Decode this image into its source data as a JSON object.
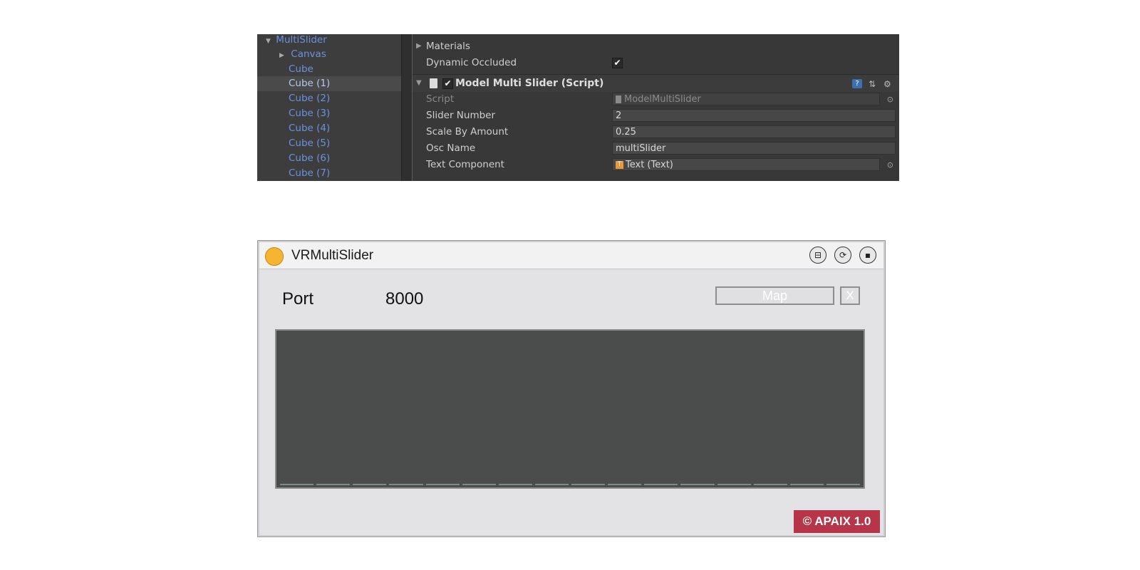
{
  "unity": {
    "hierarchy": {
      "root": "MultiSlider",
      "items": [
        {
          "label": "Canvas",
          "expandable": true
        },
        {
          "label": "Cube"
        },
        {
          "label": "Cube (1)",
          "selected": true
        },
        {
          "label": "Cube (2)"
        },
        {
          "label": "Cube (3)"
        },
        {
          "label": "Cube (4)"
        },
        {
          "label": "Cube (5)"
        },
        {
          "label": "Cube (6)"
        },
        {
          "label": "Cube (7)"
        }
      ]
    },
    "inspector": {
      "materials_label": "Materials",
      "dynamic_occluded_label": "Dynamic Occluded",
      "dynamic_occluded_checked": true,
      "component_title": "Model Multi Slider (Script)",
      "component_enabled": true,
      "fields": {
        "script_label": "Script",
        "script_value": "ModelMultiSlider",
        "slider_number_label": "Slider Number",
        "slider_number_value": "2",
        "scale_label": "Scale By Amount",
        "scale_value": "0.25",
        "osc_label": "Osc Name",
        "osc_value": "multiSlider",
        "text_component_label": "Text Component",
        "text_component_value": "Text (Text)"
      },
      "icons": [
        "help-icon",
        "preset-icon",
        "gear-icon"
      ]
    }
  },
  "max_patch": {
    "title": "VRMultiSlider",
    "status_color": "#f5b432",
    "title_buttons": [
      "freeze-icon",
      "refresh-icon",
      "save-icon"
    ],
    "port_label": "Port",
    "port_value": "8000",
    "map_button": "Map",
    "close_button": "X",
    "slider_count": 16,
    "slider_values": [
      0,
      0,
      0,
      0,
      0,
      0,
      0,
      0,
      0,
      0,
      0,
      0,
      0,
      0,
      0,
      0
    ],
    "badge": "© APAIX 1.0",
    "badge_color": "#b73548"
  }
}
